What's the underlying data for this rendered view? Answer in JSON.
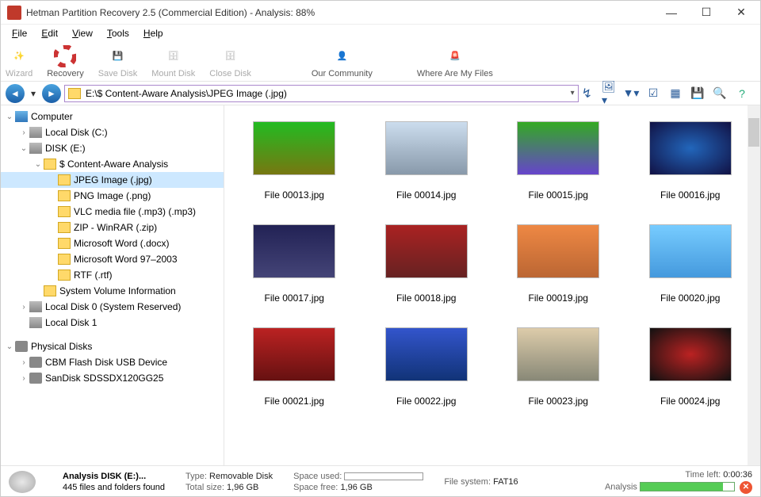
{
  "window": {
    "title": "Hetman Partition Recovery 2.5 (Commercial Edition) - Analysis: 88%"
  },
  "menu": {
    "file": "File",
    "edit": "Edit",
    "view": "View",
    "tools": "Tools",
    "help": "Help"
  },
  "toolbar": {
    "wizard": "Wizard",
    "recovery": "Recovery",
    "saveDisk": "Save Disk",
    "mountDisk": "Mount Disk",
    "closeDisk": "Close Disk",
    "community": "Our Community",
    "whereFiles": "Where Are My Files"
  },
  "address": {
    "path": "E:\\$ Content-Aware Analysis\\JPEG Image (.jpg)"
  },
  "tree": {
    "computer": "Computer",
    "localC": "Local Disk (C:)",
    "diskE": "DISK (E:)",
    "contentAware": "$ Content-Aware Analysis",
    "jpeg": "JPEG Image (.jpg)",
    "png": "PNG Image (.png)",
    "vlc": "VLC media file (.mp3) (.mp3)",
    "zip": "ZIP - WinRAR (.zip)",
    "docx": "Microsoft Word (.docx)",
    "doc97": "Microsoft Word 97–2003",
    "rtf": "RTF (.rtf)",
    "svi": "System Volume Information",
    "local0": "Local Disk 0 (System Reserved)",
    "local1": "Local Disk 1",
    "physical": "Physical Disks",
    "cbm": "CBM Flash Disk USB Device",
    "sandisk": "SanDisk SDSSDX120GG25"
  },
  "files": [
    {
      "name": "File 00013.jpg",
      "bg": "linear-gradient(#2b2,#771),#5a3"
    },
    {
      "name": "File 00014.jpg",
      "bg": "linear-gradient(#cde,#89a)"
    },
    {
      "name": "File 00015.jpg",
      "bg": "linear-gradient(#3a2,#64c)"
    },
    {
      "name": "File 00016.jpg",
      "bg": "radial-gradient(#26b,#114)"
    },
    {
      "name": "File 00017.jpg",
      "bg": "linear-gradient(#225,#447)"
    },
    {
      "name": "File 00018.jpg",
      "bg": "linear-gradient(#a22,#622)"
    },
    {
      "name": "File 00019.jpg",
      "bg": "linear-gradient(#e84,#b63)"
    },
    {
      "name": "File 00020.jpg",
      "bg": "linear-gradient(#7cf,#49d)"
    },
    {
      "name": "File 00021.jpg",
      "bg": "linear-gradient(#b22,#611)"
    },
    {
      "name": "File 00022.jpg",
      "bg": "linear-gradient(#35c,#137)"
    },
    {
      "name": "File 00023.jpg",
      "bg": "linear-gradient(#dca,#887)"
    },
    {
      "name": "File 00024.jpg",
      "bg": "radial-gradient(#b22,#111)"
    }
  ],
  "status": {
    "analysisOf": "Analysis DISK (E:)...",
    "found": "445 files and folders found",
    "typeLabel": "Type:",
    "typeVal": "Removable Disk",
    "totalLabel": "Total size:",
    "totalVal": "1,96 GB",
    "usedLabel": "Space used:",
    "freeLabel": "Space free:",
    "freeVal": "1,96 GB",
    "fsLabel": "File system:",
    "fsVal": "FAT16",
    "timeLabel": "Time left:",
    "timeVal": "0:00:36",
    "analysisLabel": "Analysis"
  }
}
